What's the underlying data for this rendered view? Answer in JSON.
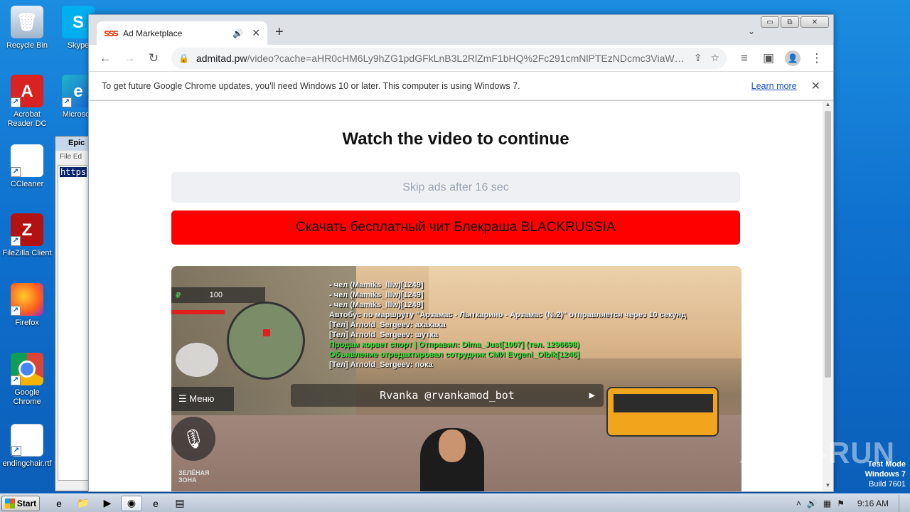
{
  "desktop": {
    "icons": [
      {
        "label": "Recycle Bin",
        "icon": "recycle-bin-icon",
        "glyph": "🗑"
      },
      {
        "label": "Skype",
        "icon": "skype-icon",
        "glyph": "S"
      },
      {
        "label": "Acrobat Reader DC",
        "icon": "acrobat-icon",
        "glyph": "A"
      },
      {
        "label": "Microsoft",
        "icon": "edge-icon",
        "glyph": "e"
      },
      {
        "label": "CCleaner",
        "icon": "ccleaner-icon",
        "glyph": "C"
      },
      {
        "label": "FileZilla Client",
        "icon": "filezilla-icon",
        "glyph": "Z"
      },
      {
        "label": "Firefox",
        "icon": "firefox-icon",
        "glyph": ""
      },
      {
        "label": "Google Chrome",
        "icon": "chrome-icon",
        "glyph": ""
      },
      {
        "label": "endingchair.rtf",
        "icon": "word-document-icon",
        "glyph": "W"
      }
    ],
    "editor": {
      "title": "Epic",
      "menu": "File   Ed",
      "content": "https"
    },
    "watermark": "ANY▷RUN",
    "test_mode": {
      "line1": "Test Mode",
      "line2": "Windows 7",
      "line3": "Build 7601"
    }
  },
  "browser": {
    "tab": {
      "title": "Ad Marketplace",
      "favicon": "ꜱꜱꜱ"
    },
    "new_tab": "+",
    "tab_list": "⌄",
    "window_controls": {
      "minimize": "▭",
      "restore": "⧉",
      "close": "✕"
    },
    "toolbar": {
      "back": "←",
      "forward": "→",
      "reload": "↻"
    },
    "address": {
      "host": "admitad.pw",
      "path": "/video?cache=aHR0cHM6Ly9hZG1pdGFkLnB3L2RlZmF1bHQ%2Fc291cmNlPTEzNDcmc3ViaWQ9TF..."
    },
    "infobar": {
      "message": "To get future Google Chrome updates, you'll need Windows 10 or later. This computer is using Windows 7.",
      "learn_more": "Learn more"
    }
  },
  "page": {
    "heading": "Watch the video to continue",
    "skip_label": "Skip ads after 16 sec",
    "cta_label": "Скачать бесплатный чит Блекраша BLACKRUSSIA",
    "cta_color": "#ff0000",
    "video": {
      "money": "100",
      "currency": "₽",
      "menu_label": "☰ Меню",
      "zone_label": "ЗЕЛЁНАЯ\nЗОНА",
      "watermark": "Rvanka @rvankamod_bot",
      "chat": [
        {
          "text": "- чел (Mamiks_lllw)[1249]",
          "kind": "system"
        },
        {
          "text": "- чел (Mamiks_lllw)[1249]",
          "kind": "system"
        },
        {
          "text": "- чел (Mamiks_lllw)[1249]",
          "kind": "system"
        },
        {
          "text": "Автобус по маршруту \"Арзамас - Лыткарино - Арзамас (№2)\" отправляется через 10 секунд",
          "kind": "system"
        },
        {
          "text": "[Тел] Arnold_Sergeev: ахахаха",
          "kind": "system"
        },
        {
          "text": "[Тел] Arnold_Sergeev: шутка",
          "kind": "system"
        },
        {
          "text": "Продам корвет спорт | Отправил: Dima_Just[1007] (тел. 1296698)",
          "kind": "green"
        },
        {
          "text": "Объявление отредактировал сотрудник СМИ Evgeni_Olbik[1246]",
          "kind": "green"
        },
        {
          "text": "[Тел] Arnold_Sergeev: пока",
          "kind": "system"
        }
      ]
    }
  },
  "taskbar": {
    "start_label": "Start",
    "tasks": [
      {
        "icon": "internet-explorer-icon",
        "glyph": "e",
        "active": false
      },
      {
        "icon": "folder-icon",
        "glyph": "📁",
        "active": false
      },
      {
        "icon": "media-player-icon",
        "glyph": "▶",
        "active": false
      },
      {
        "icon": "chrome-taskbar-icon",
        "glyph": "◉",
        "active": true
      },
      {
        "icon": "edge-taskbar-icon",
        "glyph": "e",
        "active": false
      },
      {
        "icon": "notepad-icon",
        "glyph": "▤",
        "active": false
      }
    ],
    "clock": "9:16 AM"
  }
}
